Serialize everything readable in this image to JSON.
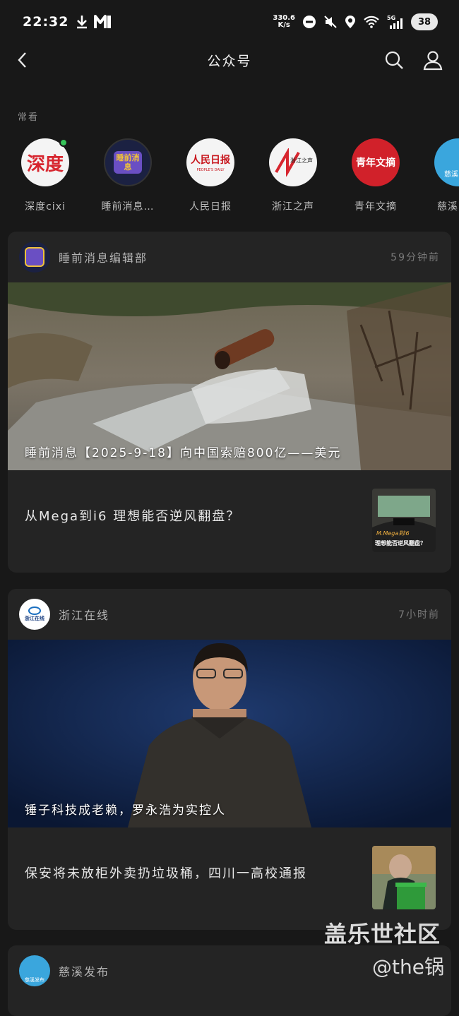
{
  "status_bar": {
    "time": "22:32",
    "speed_value": "330.6",
    "speed_unit": "K/s",
    "battery": "38",
    "network": "5G"
  },
  "header": {
    "title": "公众号"
  },
  "frequent": {
    "label": "常看",
    "items": [
      {
        "name": "深度cixi",
        "logo_text": "深度",
        "unread": true
      },
      {
        "name": "睡前消息…",
        "logo_text": "睡前消息",
        "unread": false
      },
      {
        "name": "人民日报",
        "logo_text": "人民日报",
        "logo_sub": "PEOPLE'S DAILY",
        "unread": false
      },
      {
        "name": "浙江之声",
        "logo_text": "浙江之声",
        "unread": false
      },
      {
        "name": "青年文摘",
        "logo_text": "青年文摘",
        "unread": false
      },
      {
        "name": "慈溪",
        "logo_text": "慈溪",
        "unread": false
      }
    ]
  },
  "articles": [
    {
      "account": "睡前消息编辑部",
      "time": "59分钟前",
      "hero_title": "睡前消息【2025-9-18】向中国索赔800亿——美元",
      "sub_title": "从Mega到i6 理想能否逆风翻盘？",
      "sub_thumb_text": "M.Mega到i6",
      "sub_thumb_caption": "理想能否逆风翻盘？"
    },
    {
      "account": "浙江在线",
      "account_logo_text": "浙江在线",
      "time": "7小时前",
      "hero_title": "锤子科技成老赖，罗永浩为实控人",
      "sub_title": "保安将未放柜外卖扔垃圾桶，四川一高校通报"
    },
    {
      "account": "慈溪发布",
      "account_logo_text": "慈溪发布"
    }
  ],
  "watermark": {
    "line1": "盖乐世社区",
    "line2": "@the锅"
  },
  "colors": {
    "background": "#181818",
    "card": "#242424",
    "unread_dot": "#37c45a",
    "shendu_red": "#d7262f",
    "renmin_red": "#c8161d",
    "qingnian_red": "#d1212a"
  }
}
